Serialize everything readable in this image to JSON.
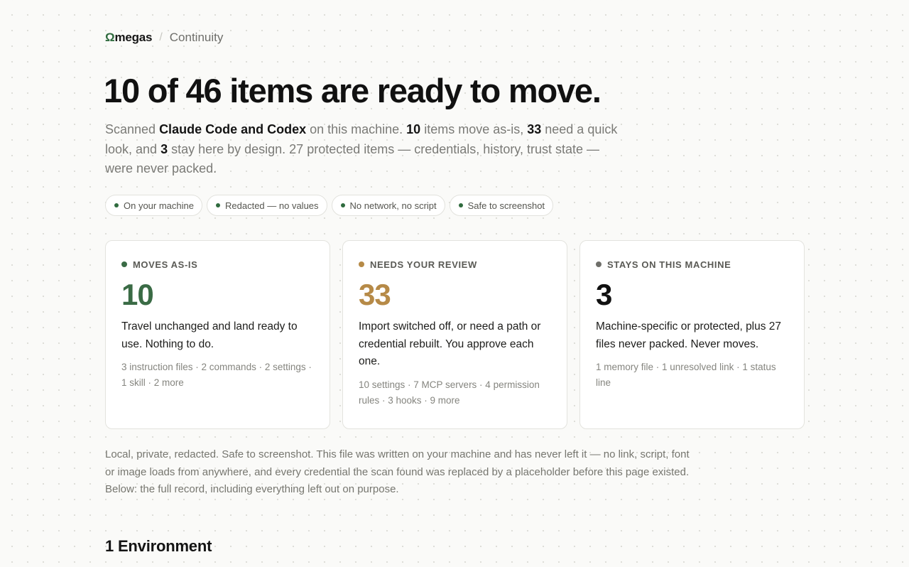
{
  "header": {
    "brand_mark": "Ω",
    "brand_rest": "megas",
    "separator": "/",
    "section": "Continuity"
  },
  "headline": "10 of 46 items are ready to move.",
  "summary": {
    "t1": "Scanned ",
    "agents": "Claude Code and Codex",
    "t2": " on this machine. ",
    "moves_count": "10",
    "t3": " items move as-is, ",
    "review_count": "33",
    "t4": " need a quick look, and ",
    "stay_count": "3",
    "t5": " stay here by design. 27 protected items — credentials, history, trust state — were never packed."
  },
  "pills": [
    "On your machine",
    "Redacted — no values",
    "No network, no script",
    "Safe to screenshot"
  ],
  "cards": [
    {
      "label": "MOVES AS-IS",
      "count": "10",
      "desc": "Travel unchanged and land ready to use. Nothing to do.",
      "meta": "3 instruction files · 2 commands · 2 settings · 1 skill · 2 more",
      "color": "#3a6b45"
    },
    {
      "label": "NEEDS YOUR REVIEW",
      "count": "33",
      "desc": "Import switched off, or need a path or credential rebuilt. You approve each one.",
      "meta": "10 settings · 7 MCP servers · 4 permission rules · 3 hooks · 9 more",
      "color": "#b68a47"
    },
    {
      "label": "STAYS ON THIS MACHINE",
      "count": "3",
      "desc": "Machine-specific or protected, plus 27 files never packed. Never moves.",
      "meta": "1 memory file · 1 unresolved link · 1 status line",
      "color": "#111111",
      "dot_color": "#6f6f6a"
    }
  ],
  "privacy_note": "Local, private, redacted. Safe to screenshot. This file was written on your machine and has never left it — no link, script, font or image loads from anywhere, and every credential the scan found was replaced by a placeholder before this page existed. Below: the full record, including everything left out on purpose.",
  "next_section": "1 Environment"
}
